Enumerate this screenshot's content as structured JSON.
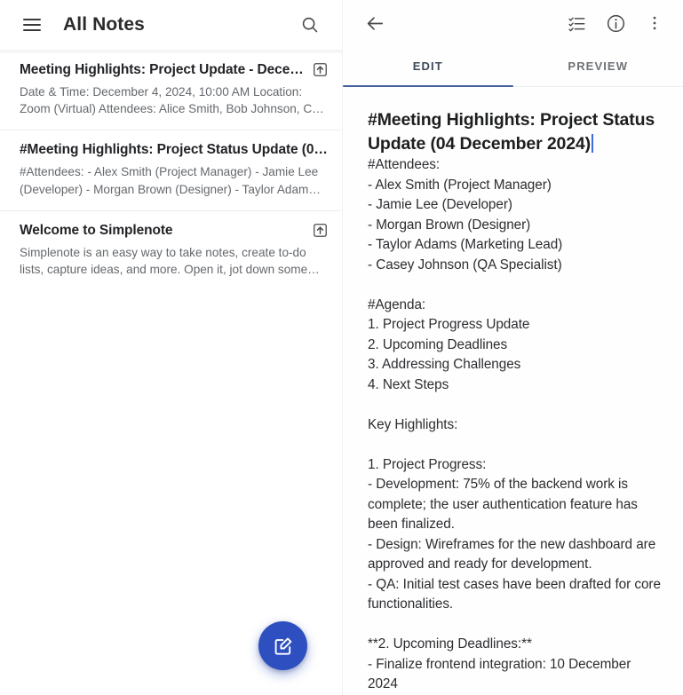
{
  "left": {
    "toolbar": {
      "menu_icon": "hamburger-menu-icon",
      "title": "All Notes",
      "search_icon": "search-icon"
    },
    "notes": [
      {
        "title": "Meeting Highlights: Project Update - Dece…",
        "preview": "Date & Time: December 4, 2024, 10:00 AM   Location: Zoom (Virtual)   Attendees: Alice Smith, Bob Johnson, C…",
        "published": true
      },
      {
        "title": "#Meeting Highlights: Project Status Update (04…",
        "preview": "#Attendees: - Alex Smith (Project Manager)  - Jamie Lee (Developer)  - Morgan Brown (Designer)  - Taylor Adam…",
        "published": false
      },
      {
        "title": "Welcome to Simplenote",
        "preview": "Simplenote is an easy way to take notes, create to-do lists, capture ideas, and more. Open it, jot down some t…",
        "published": true
      }
    ],
    "fab": {
      "label": "New note",
      "icon": "new-note-pencil-icon",
      "color": "#2d4fc0"
    }
  },
  "right": {
    "toolbar": {
      "back_icon": "back-arrow-icon",
      "checklist_icon": "checklist-icon",
      "info_icon": "info-circle-icon",
      "more_icon": "more-vertical-icon"
    },
    "tabs": [
      {
        "label": "EDIT",
        "active": true
      },
      {
        "label": "PREVIEW",
        "active": false
      }
    ],
    "tab_accent_color": "#45619d",
    "note": {
      "title": "#Meeting Highlights: Project Status Update (04 December 2024)",
      "body": "#Attendees:\n- Alex Smith (Project Manager)\n- Jamie Lee (Developer)\n- Morgan Brown (Designer)\n- Taylor Adams (Marketing Lead)\n- Casey Johnson (QA Specialist)\n\n#Agenda:\n1. Project Progress Update\n2. Upcoming Deadlines\n3. Addressing Challenges\n4. Next Steps\n\nKey Highlights:\n\n1. Project Progress:\n- Development: 75% of the backend work is complete; the user authentication feature has been finalized.\n- Design: Wireframes for the new dashboard are approved and ready for development.\n- QA: Initial test cases have been drafted for core functionalities.\n\n**2. Upcoming Deadlines:**\n- Finalize frontend integration: 10 December 2024"
    }
  }
}
